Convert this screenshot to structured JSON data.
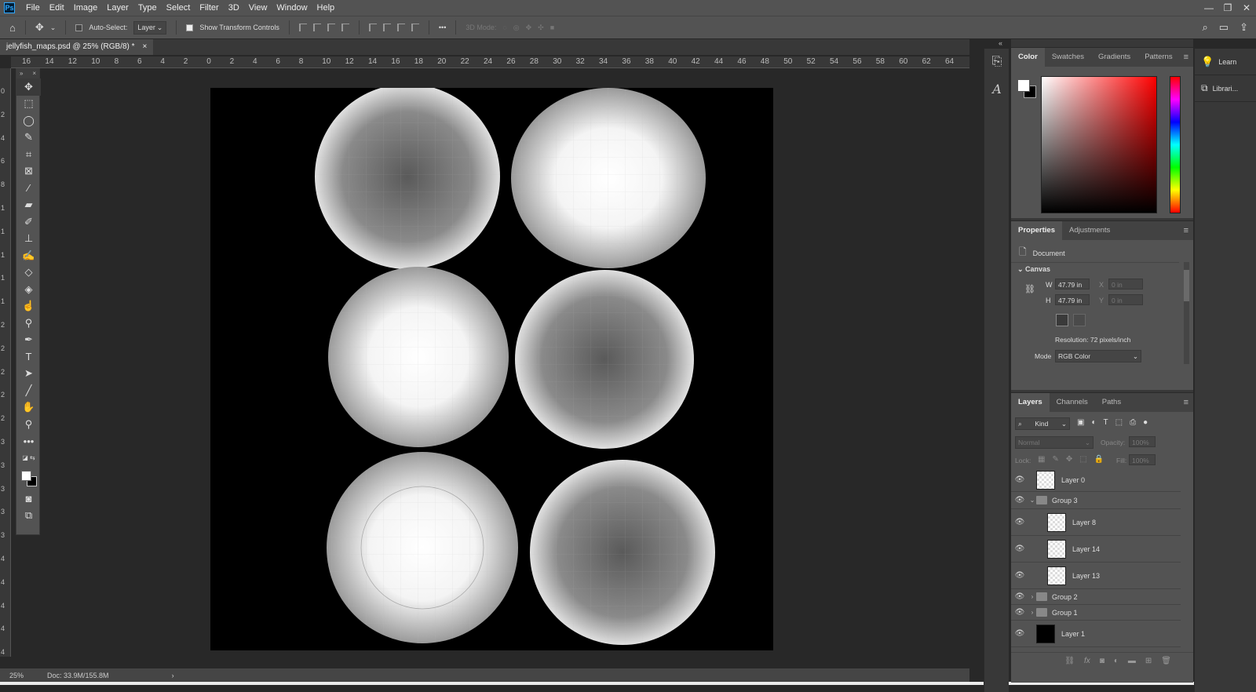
{
  "app": {
    "logo": "Ps"
  },
  "menu": [
    "File",
    "Edit",
    "Image",
    "Layer",
    "Type",
    "Select",
    "Filter",
    "3D",
    "View",
    "Window",
    "Help"
  ],
  "window_controls": [
    "—",
    "❐",
    "✕"
  ],
  "options": {
    "auto_select_label": "Auto-Select:",
    "auto_select_value": "Layer",
    "show_transform_label": "Show Transform Controls",
    "mode_3d_label": "3D Mode:",
    "more": "•••"
  },
  "document": {
    "tab_title": "jellyfish_maps.psd @ 25% (RGB/8) *",
    "close": "×"
  },
  "rulers": {
    "h_labels": [
      "16",
      "14",
      "12",
      "10",
      "8",
      "6",
      "4",
      "2",
      "0",
      "2",
      "4",
      "6",
      "8",
      "10",
      "12",
      "14",
      "16",
      "18",
      "20",
      "22",
      "24",
      "26",
      "28",
      "30",
      "32",
      "34",
      "36",
      "38",
      "40",
      "42",
      "44",
      "46",
      "48",
      "50",
      "52",
      "54",
      "56",
      "58",
      "60",
      "62",
      "64"
    ],
    "v_labels": [
      "0",
      "2",
      "4",
      "6",
      "8",
      "10",
      "12",
      "14",
      "16",
      "18",
      "20",
      "22",
      "24",
      "26",
      "28",
      "30",
      "32",
      "34",
      "36",
      "38",
      "40",
      "42",
      "44",
      "46",
      "48"
    ]
  },
  "toolbox": {
    "collapse": "»",
    "close": "×"
  },
  "status": {
    "zoom": "25%",
    "doc": "Doc: 33.9M/155.8M",
    "arrow": "›"
  },
  "color_panel": {
    "tabs": [
      "Color",
      "Swatches",
      "Gradients",
      "Patterns"
    ],
    "active": 0
  },
  "properties_panel": {
    "tabs": [
      "Properties",
      "Adjustments"
    ],
    "kind_label": "Document",
    "section": "Canvas",
    "w_label": "W",
    "w_value": "47.79 in",
    "h_label": "H",
    "h_value": "47.79 in",
    "x_label": "X",
    "x_value": "0 in",
    "y_label": "Y",
    "y_value": "0 in",
    "resolution": "Resolution: 72 pixels/inch",
    "mode_label": "Mode",
    "mode_value": "RGB Color"
  },
  "layers_panel": {
    "tabs": [
      "Layers",
      "Channels",
      "Paths"
    ],
    "filter_kind": "Kind",
    "blend_mode": "Normal",
    "opacity_label": "Opacity:",
    "opacity_value": "100%",
    "lock_label": "Lock:",
    "fill_label": "Fill:",
    "fill_value": "100%",
    "layers": [
      {
        "name": "Layer 0",
        "type": "layer",
        "indent": 0
      },
      {
        "name": "Group 3",
        "type": "group",
        "expanded": true,
        "indent": 0
      },
      {
        "name": "Layer 8",
        "type": "layer",
        "indent": 1
      },
      {
        "name": "Layer 14",
        "type": "layer",
        "indent": 1
      },
      {
        "name": "Layer 13",
        "type": "layer",
        "indent": 1
      },
      {
        "name": "Group 2",
        "type": "group",
        "expanded": false,
        "indent": 0
      },
      {
        "name": "Group 1",
        "type": "group",
        "expanded": false,
        "indent": 0
      },
      {
        "name": "Layer 1",
        "type": "layer-black",
        "indent": 0
      }
    ]
  },
  "right_strip": {
    "learn": "Learn",
    "libraries": "Librari..."
  }
}
